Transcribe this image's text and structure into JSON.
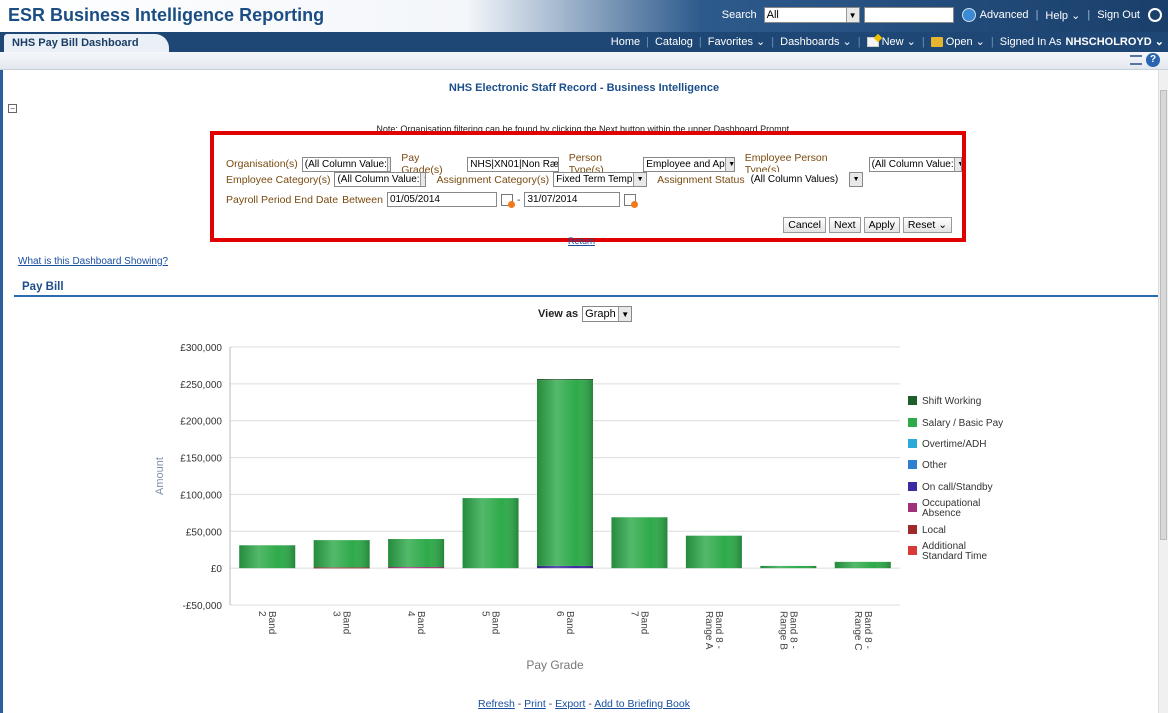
{
  "app": {
    "title": "ESR Business Intelligence Reporting"
  },
  "topbar": {
    "search_label": "Search",
    "search_scope": "All",
    "search_value": "",
    "advanced": "Advanced",
    "help": "Help ⌄",
    "sign_out": "Sign Out"
  },
  "navbar": {
    "active_tab": "NHS Pay Bill Dashboard",
    "home": "Home",
    "catalog": "Catalog",
    "favorites": "Favorites ⌄",
    "dashboards": "Dashboards ⌄",
    "new": "New ⌄",
    "open": "Open ⌄",
    "signed_in_label": "Signed In As",
    "signed_in_user": "NHSCHOLROYD ⌄"
  },
  "page": {
    "heading": "NHS Electronic Staff Record - Business Intelligence",
    "note": "Note: Organisation filtering can be found by clicking the Next button within the upper Dashboard Prompt.",
    "return_link": "Return",
    "what_link": "What is this Dashboard Showing?",
    "section_title": "Pay Bill",
    "view_as_label": "View as",
    "view_as_value": "Graph"
  },
  "prompt": {
    "organisation_label": "Organisation(s)",
    "organisation_value": "(All Column Value:",
    "pay_grade_label": "Pay Grade(s)",
    "pay_grade_value": "NHS|XN01|Non Ræ",
    "person_type_label": "Person Type(s)",
    "person_type_value": "Employee and Ap",
    "emp_person_type_label": "Employee Person Type(s)",
    "emp_person_type_value": "(All Column Value:",
    "emp_category_label": "Employee Category(s)",
    "emp_category_value": "(All Column Value:",
    "assign_category_label": "Assignment Category(s)",
    "assign_category_value": "Fixed Term Temp",
    "assign_status_label": "Assignment Status",
    "assign_status_value": "(All Column Values)",
    "payroll_label": "Payroll Period End Date",
    "between_label": "Between",
    "date_from": "01/05/2014",
    "date_sep": "- ",
    "date_to": "31/07/2014",
    "cancel": "Cancel",
    "next": "Next",
    "apply": "Apply",
    "reset": "Reset ⌄"
  },
  "footer": {
    "refresh": "Refresh",
    "print": "Print",
    "export": "Export",
    "briefing": "Add to Briefing Book",
    "dash": " - "
  },
  "chart_data": {
    "type": "bar",
    "stacked": true,
    "xlabel": "Pay Grade",
    "ylabel": "Amount",
    "ylim": [
      -50000,
      300000
    ],
    "yticks": [
      -50000,
      0,
      50000,
      100000,
      150000,
      200000,
      250000,
      300000
    ],
    "ytick_labels": [
      "-£50,000",
      "£0",
      "£50,000",
      "£100,000",
      "£150,000",
      "£200,000",
      "£250,000",
      "£300,000"
    ],
    "categories": [
      "Band 2",
      "Band 3",
      "Band 4",
      "Band 5",
      "Band 6",
      "Band 7",
      "Band 8 - Range A",
      "Band 8 - Range B",
      "Band 8 - Range C"
    ],
    "category_lines": [
      [
        "Band",
        "2"
      ],
      [
        "Band",
        "3"
      ],
      [
        "Band",
        "4"
      ],
      [
        "Band",
        "5"
      ],
      [
        "Band",
        "6"
      ],
      [
        "Band",
        "7"
      ],
      [
        "Band 8 -",
        "Range A"
      ],
      [
        "Band 8 -",
        "Range B"
      ],
      [
        "Band 8 -",
        "Range C"
      ]
    ],
    "legend_position": "right",
    "series": [
      {
        "name": "Shift Working",
        "color": "#1e5e2a",
        "values": [
          0,
          0,
          0,
          0,
          1500,
          0,
          0,
          0,
          0
        ]
      },
      {
        "name": "Salary / Basic Pay",
        "color": "#2eaa4a",
        "values": [
          31000,
          37000,
          38000,
          95000,
          252000,
          69000,
          44000,
          3000,
          8500
        ]
      },
      {
        "name": "Overtime/ADH",
        "color": "#2aaad8",
        "values": [
          0,
          0,
          0,
          0,
          0,
          0,
          0,
          0,
          0
        ]
      },
      {
        "name": "Other",
        "color": "#2f7fd0",
        "values": [
          0,
          0,
          0,
          0,
          0,
          0,
          0,
          0,
          0
        ]
      },
      {
        "name": "On call/Standby",
        "color": "#3a2ca0",
        "values": [
          0,
          0,
          0,
          0,
          3000,
          0,
          0,
          0,
          0
        ]
      },
      {
        "name": "Occupational Absence",
        "color": "#a0307a",
        "values": [
          0,
          0,
          1500,
          0,
          0,
          0,
          0,
          0,
          0
        ]
      },
      {
        "name": "Local",
        "color": "#9e2a2a",
        "values": [
          0,
          1000,
          0,
          0,
          0,
          0,
          0,
          0,
          0
        ]
      },
      {
        "name": "Additional Standard Time",
        "color": "#d83a3a",
        "values": [
          0,
          0,
          0,
          0,
          0,
          0,
          0,
          0,
          0
        ]
      }
    ]
  }
}
